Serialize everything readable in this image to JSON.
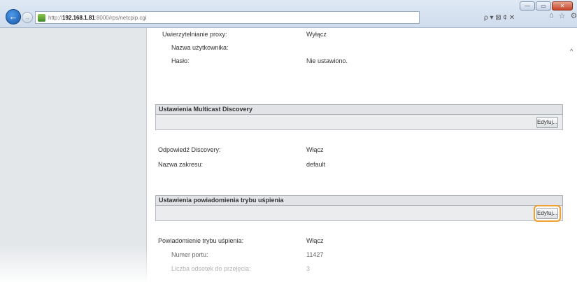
{
  "browser": {
    "url_prefix": "http://",
    "url_host": "192.168.1.81",
    "url_path": ":8000/rps/netcpip.cgi",
    "search_tools": "ρ ▾ ⊠ ¢ ✕",
    "win_min": "—",
    "win_max": "▭",
    "win_close": "✕"
  },
  "proxy": {
    "auth_label": "Uwierzytelnianie proxy:",
    "auth_value": "Wyłącz",
    "user_label": "Nazwa użytkownika:",
    "user_value": "",
    "pass_label": "Hasło:",
    "pass_value": "Nie ustawiono."
  },
  "multicast": {
    "title": "Ustawienia Multicast Discovery",
    "edit_label": "Edytuj...",
    "response_label": "Odpowiedź Discovery:",
    "response_value": "Włącz",
    "scope_label": "Nazwa zakresu:",
    "scope_value": "default"
  },
  "sleep": {
    "title": "Ustawienia powiadomienia trybu uśpienia",
    "edit_label": "Edytuj...",
    "notify_label": "Powiadomienie trybu uśpienia:",
    "notify_value": "Włącz",
    "port_label": "Numer portu:",
    "port_value": "11427",
    "count_label": "Liczba odsetek do przejęcia:",
    "count_value": "3"
  }
}
